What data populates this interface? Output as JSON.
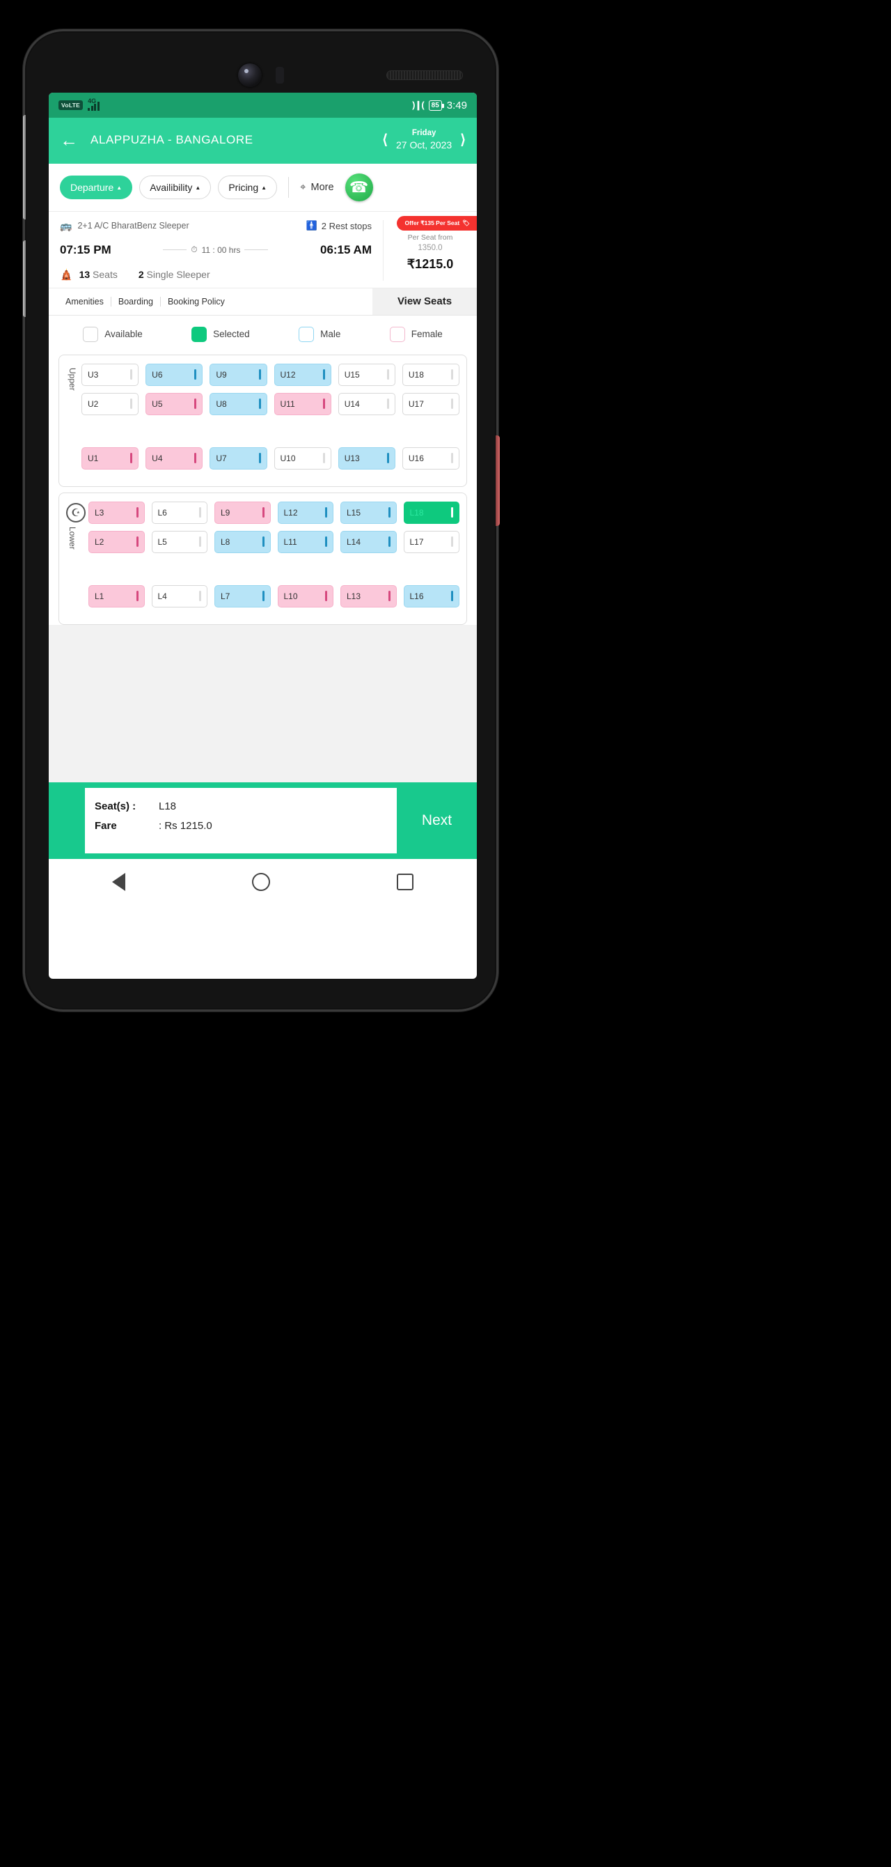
{
  "statusbar": {
    "volte": "VoLTE",
    "network": "4G",
    "vibrate_icon": "vibrate-icon",
    "battery": "85",
    "time": "3:49"
  },
  "appbar": {
    "back_icon": "back-arrow-icon",
    "route": "ALAPPUZHA - BANGALORE",
    "day": "Friday",
    "date": "27 Oct, 2023",
    "prev_icon": "chevron-left-icon",
    "next_icon": "chevron-right-icon"
  },
  "filters": {
    "chips": [
      {
        "label": "Departure",
        "active": true
      },
      {
        "label": "Availibility",
        "active": false
      },
      {
        "label": "Pricing",
        "active": false
      }
    ],
    "more_label": "More",
    "more_icon": "filter-sliders-icon",
    "whatsapp_icon": "whatsapp-icon"
  },
  "bus": {
    "type": "2+1 A/C BharatBenz Sleeper",
    "bus_icon": "bus-icon",
    "rest_stops": "2 Rest stops",
    "rest_icon": "restroom-icon",
    "departure_time": "07:15 PM",
    "arrival_time": "06:15 AM",
    "duration": "11 : 00 hrs",
    "duration_icon": "stopwatch-icon",
    "seats_count": "13",
    "seats_label": "Seats",
    "seat_icon": "seat-icon",
    "single_count": "2",
    "single_label": "Single Sleeper",
    "price_label": "Per Seat from",
    "price_old": "1350.0",
    "price_new": "₹1215.0",
    "offer": "Offer ₹135 Per Seat",
    "offer_icon": "tag-icon"
  },
  "tabs": {
    "items": [
      "Amenities",
      "Boarding",
      "Booking Policy"
    ],
    "view_seats": "View Seats"
  },
  "legend": [
    {
      "label": "Available",
      "state": "available"
    },
    {
      "label": "Selected",
      "state": "selected"
    },
    {
      "label": "Male",
      "state": "male"
    },
    {
      "label": "Female",
      "state": "female"
    }
  ],
  "decks": [
    {
      "name": "Upper",
      "label": "Upper",
      "has_wheel": false,
      "rows": [
        [
          {
            "id": "U3",
            "state": "available"
          },
          {
            "id": "U6",
            "state": "male"
          },
          {
            "id": "U9",
            "state": "male"
          },
          {
            "id": "U12",
            "state": "male"
          },
          {
            "id": "U15",
            "state": "available"
          },
          {
            "id": "U18",
            "state": "available"
          }
        ],
        [
          {
            "id": "U2",
            "state": "available"
          },
          {
            "id": "U5",
            "state": "female"
          },
          {
            "id": "U8",
            "state": "male"
          },
          {
            "id": "U11",
            "state": "female"
          },
          {
            "id": "U14",
            "state": "available"
          },
          {
            "id": "U17",
            "state": "available"
          }
        ],
        [
          {
            "id": "U1",
            "state": "female"
          },
          {
            "id": "U4",
            "state": "female"
          },
          {
            "id": "U7",
            "state": "male"
          },
          {
            "id": "U10",
            "state": "available"
          },
          {
            "id": "U13",
            "state": "male"
          },
          {
            "id": "U16",
            "state": "available"
          }
        ]
      ]
    },
    {
      "name": "Lower",
      "label": "Lower",
      "has_wheel": true,
      "wheel_icon": "steering-wheel-icon",
      "rows": [
        [
          {
            "id": "L3",
            "state": "female"
          },
          {
            "id": "L6",
            "state": "available"
          },
          {
            "id": "L9",
            "state": "female"
          },
          {
            "id": "L12",
            "state": "male"
          },
          {
            "id": "L15",
            "state": "male"
          },
          {
            "id": "L18",
            "state": "selected"
          }
        ],
        [
          {
            "id": "L2",
            "state": "female"
          },
          {
            "id": "L5",
            "state": "available"
          },
          {
            "id": "L8",
            "state": "male"
          },
          {
            "id": "L11",
            "state": "male"
          },
          {
            "id": "L14",
            "state": "male"
          },
          {
            "id": "L17",
            "state": "available"
          }
        ],
        [
          {
            "id": "L1",
            "state": "female"
          },
          {
            "id": "L4",
            "state": "available"
          },
          {
            "id": "L7",
            "state": "male"
          },
          {
            "id": "L10",
            "state": "female"
          },
          {
            "id": "L13",
            "state": "female"
          },
          {
            "id": "L16",
            "state": "male"
          }
        ]
      ]
    }
  ],
  "bottom": {
    "seats_key": "Seat(s) :",
    "seats_val": "L18",
    "fare_key": "Fare",
    "fare_val": ": Rs 1215.0",
    "next_label": "Next"
  },
  "navbar": {
    "back": "nav-back-icon",
    "home": "nav-home-icon",
    "recents": "nav-recents-icon"
  },
  "colors": {
    "brand_green": "#2ed29a",
    "status_green": "#1aa06c",
    "selected_green": "#0ec97e",
    "male_blue": "#b7e4f7",
    "female_pink": "#fbc8da",
    "offer_red": "#f4322f"
  }
}
